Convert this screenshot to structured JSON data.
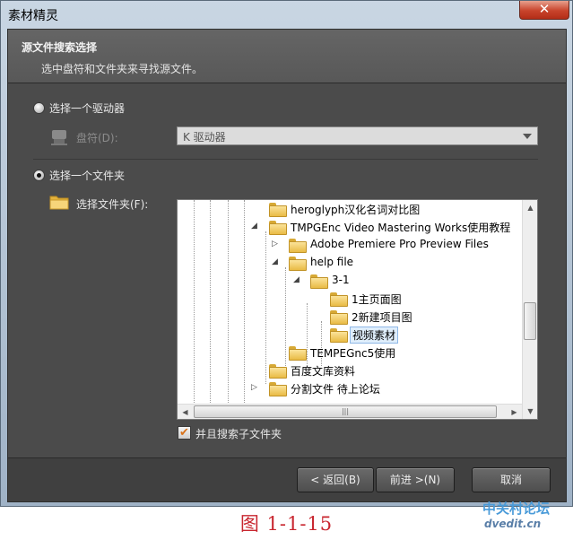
{
  "window": {
    "title": "素材精灵",
    "close_glyph": "✕"
  },
  "header": {
    "title": "源文件搜索选择",
    "subtitle": "选中盘符和文件夹来寻找源文件。"
  },
  "drive_option": {
    "label": "选择一个驱动器",
    "field_label": "盘符(D):",
    "selected": "K 驱动器",
    "checked": false
  },
  "folder_option": {
    "label": "选择一个文件夹",
    "field_label": "选择文件夹(F):",
    "checked": true
  },
  "tree": {
    "nodes": [
      {
        "label": "heroglyph汉化名词对比图",
        "depth": 0,
        "expander": ""
      },
      {
        "label": "TMPGEnc Video Mastering Works使用教程",
        "depth": 0,
        "expander": "◢"
      },
      {
        "label": "Adobe Premiere Pro Preview Files",
        "depth": 1,
        "expander": "▷"
      },
      {
        "label": "help file",
        "depth": 1,
        "expander": "◢"
      },
      {
        "label": "3-1",
        "depth": 2,
        "expander": "◢"
      },
      {
        "label": "1主页面图",
        "depth": 3,
        "expander": ""
      },
      {
        "label": "2新建项目图",
        "depth": 3,
        "expander": ""
      },
      {
        "label": "视频素材",
        "depth": 3,
        "expander": "",
        "selected": true
      },
      {
        "label": "TEMPEGnc5使用",
        "depth": 1,
        "expander": ""
      },
      {
        "label": "百度文库资料",
        "depth": 0,
        "expander": ""
      },
      {
        "label": "分割文件 待上论坛",
        "depth": 0,
        "expander": "▷"
      }
    ]
  },
  "subfolders": {
    "label": "并且搜索子文件夹",
    "checked": true,
    "check_glyph": "✔"
  },
  "buttons": {
    "back": "< 返回(B)",
    "next": "前进 >(N)",
    "cancel": "取消"
  },
  "caption": "图 1-1-15",
  "watermark": {
    "line1": "中关村论坛",
    "line2": "dvedit.cn"
  }
}
